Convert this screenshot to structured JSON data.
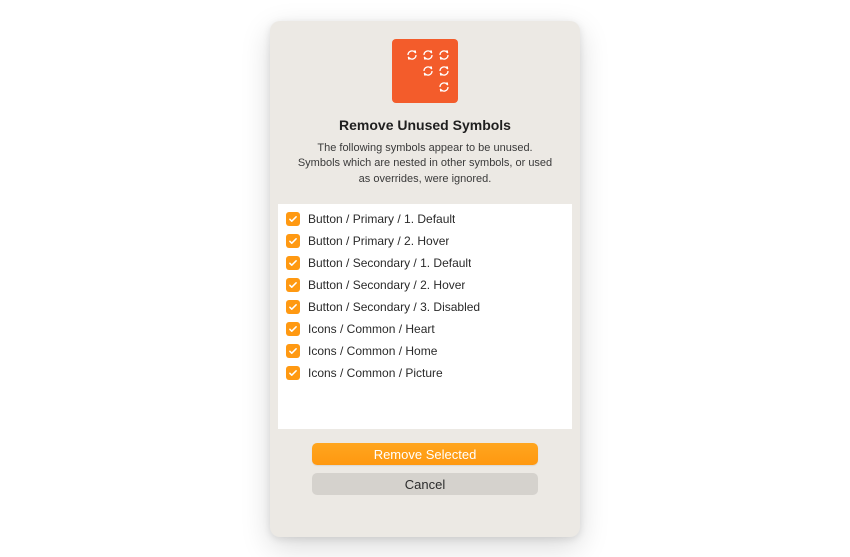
{
  "dialog": {
    "title": "Remove Unused Symbols",
    "description": "The following symbols appear to be unused. Symbols which are nested in other symbols, or used as overrides, were ignored.",
    "icon_name": "symbols-grid-icon"
  },
  "symbols": [
    {
      "checked": true,
      "label": "Button / Primary / 1. Default"
    },
    {
      "checked": true,
      "label": "Button / Primary / 2. Hover"
    },
    {
      "checked": true,
      "label": "Button / Secondary / 1. Default"
    },
    {
      "checked": true,
      "label": "Button / Secondary / 2. Hover"
    },
    {
      "checked": true,
      "label": "Button / Secondary / 3. Disabled"
    },
    {
      "checked": true,
      "label": "Icons / Common / Heart"
    },
    {
      "checked": true,
      "label": "Icons / Common / Home"
    },
    {
      "checked": true,
      "label": "Icons / Common / Picture"
    }
  ],
  "buttons": {
    "primary": "Remove Selected",
    "secondary": "Cancel"
  },
  "colors": {
    "accent": "#ff9912",
    "icon_bg": "#f35c2b"
  }
}
